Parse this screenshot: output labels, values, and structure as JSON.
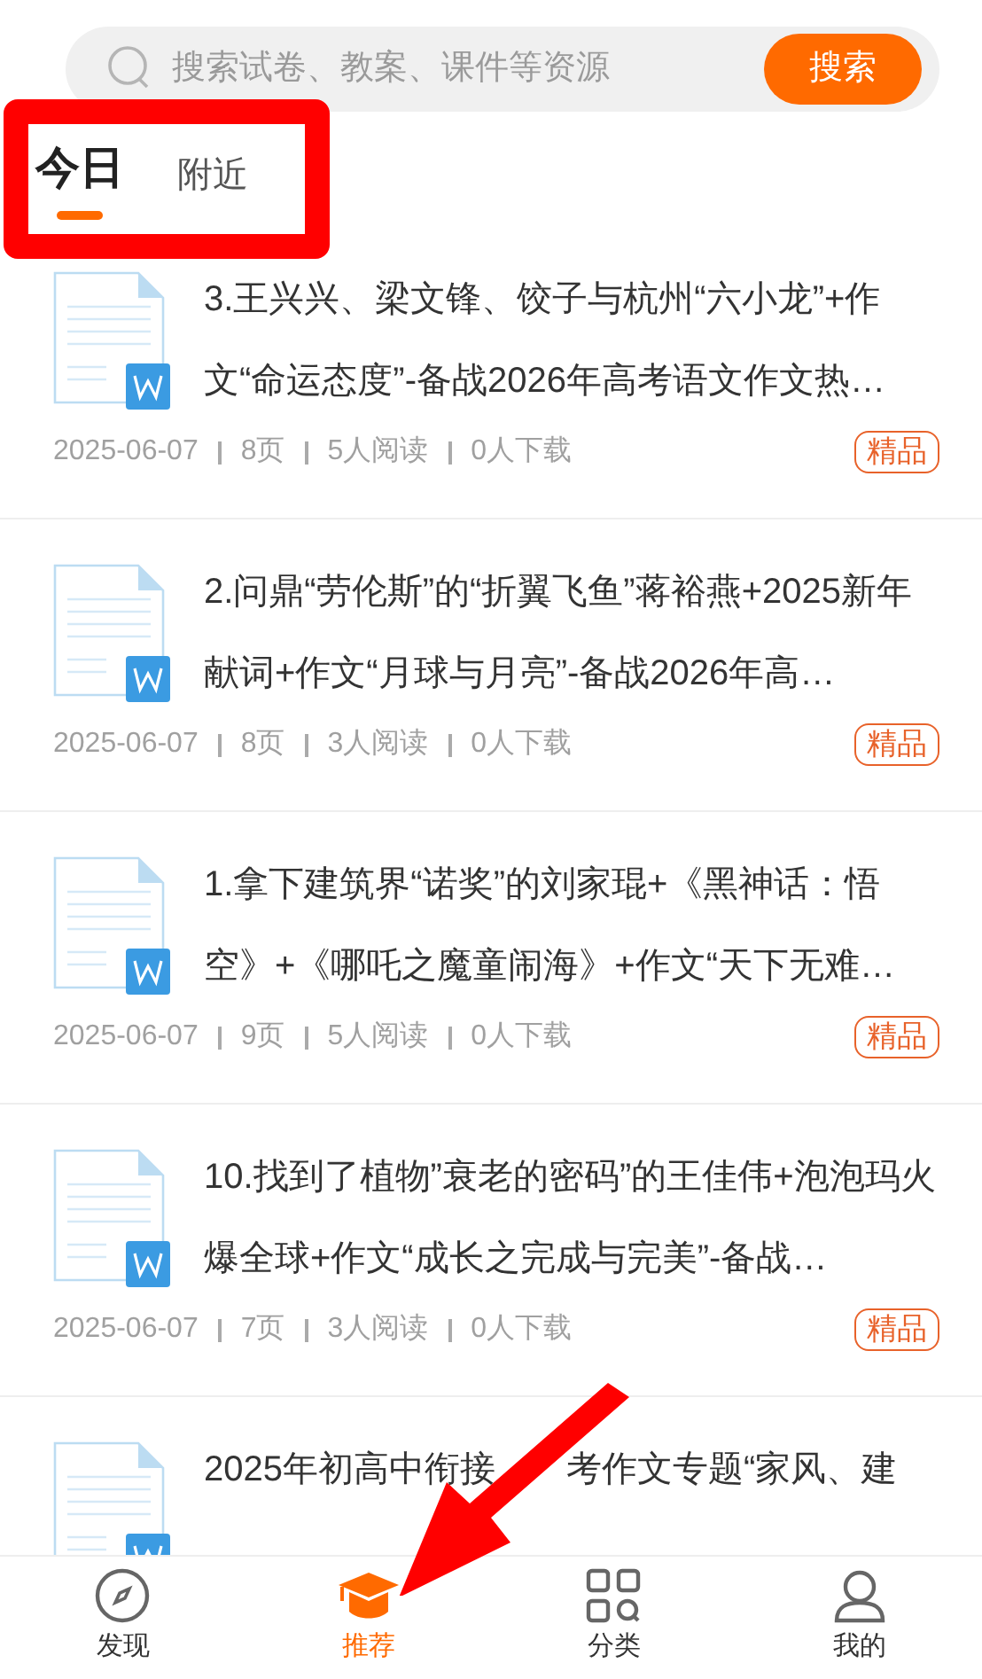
{
  "search": {
    "placeholder": "搜索试卷、教案、课件等资源",
    "button": "搜索"
  },
  "tabs": [
    {
      "label": "今日",
      "selected": true
    },
    {
      "label": "附近",
      "selected": false
    }
  ],
  "documents": [
    {
      "title": "3.王兴兴、梁文锋、饺子与杭州“六小龙”+作文“命运态度”-备战2026年高考语文作文热…",
      "date": "2025-06-07",
      "pages": "8页",
      "reads": "5人阅读",
      "downloads": "0人下载",
      "badge": "精品"
    },
    {
      "title": "2.问鼎“劳伦斯”的“折翼飞鱼”蒋裕燕+2025新年献词+作文“月球与月亮”-备战2026年高…",
      "date": "2025-06-07",
      "pages": "8页",
      "reads": "3人阅读",
      "downloads": "0人下载",
      "badge": "精品"
    },
    {
      "title": "1.拿下建筑界“诺奖”的刘家琨+《黑神话：悟空》+《哪吒之魔童闹海》+作文“天下无难…",
      "date": "2025-06-07",
      "pages": "9页",
      "reads": "5人阅读",
      "downloads": "0人下载",
      "badge": "精品"
    },
    {
      "title": "10.找到了植物”衰老的密码”的王佳伟+泡泡玛火爆全球+作文“成长之完成与完美”-备战…",
      "date": "2025-06-07",
      "pages": "7页",
      "reads": "3人阅读",
      "downloads": "0人下载",
      "badge": "精品"
    },
    {
      "title_parts": [
        "2025年初高中衔接",
        "考作文专题“家风、建"
      ]
    }
  ],
  "nav": [
    {
      "label": "发现",
      "selected": false
    },
    {
      "label": "推荐",
      "selected": true
    },
    {
      "label": "分类",
      "selected": false
    },
    {
      "label": "我的",
      "selected": false
    }
  ]
}
